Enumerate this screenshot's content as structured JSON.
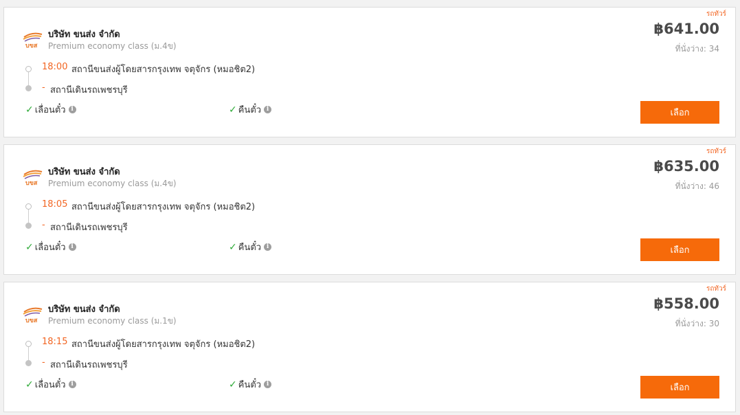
{
  "results": [
    {
      "tag": "รถทัวร์",
      "company": "บริษัท ขนส่ง จำกัด",
      "service_class": "Premium economy class (ม.4ข)",
      "price": "฿641.00",
      "seats": "ที่นั่งว่าง: 34",
      "departure_time": "18:00",
      "departure_station": "สถานีขนส่งผู้โดยสารกรุงเทพ จตุจักร (หมอชิต2)",
      "arrival_time": "-",
      "arrival_station": "สถานีเดินรถเพชรบุรี",
      "feature_1": "เลื่อนตั๋ว",
      "feature_2": "คืนตั๋ว",
      "select_label": "เลือก"
    },
    {
      "tag": "รถทัวร์",
      "company": "บริษัท ขนส่ง จำกัด",
      "service_class": "Premium economy class (ม.4ข)",
      "price": "฿635.00",
      "seats": "ที่นั่งว่าง: 46",
      "departure_time": "18:05",
      "departure_station": "สถานีขนส่งผู้โดยสารกรุงเทพ จตุจักร (หมอชิต2)",
      "arrival_time": "-",
      "arrival_station": "สถานีเดินรถเพชรบุรี",
      "feature_1": "เลื่อนตั๋ว",
      "feature_2": "คืนตั๋ว",
      "select_label": "เลือก"
    },
    {
      "tag": "รถทัวร์",
      "company": "บริษัท ขนส่ง จำกัด",
      "service_class": "Premium economy class (ม.1ข)",
      "price": "฿558.00",
      "seats": "ที่นั่งว่าง: 30",
      "departure_time": "18:15",
      "departure_station": "สถานีขนส่งผู้โดยสารกรุงเทพ จตุจักร (หมอชิต2)",
      "arrival_time": "-",
      "arrival_station": "สถานีเดินรถเพชรบุรี",
      "feature_1": "เลื่อนตั๋ว",
      "feature_2": "คืนตั๋ว",
      "select_label": "เลือก"
    }
  ],
  "icons": {
    "logo": "bks-logo-icon",
    "check": "check-icon",
    "info": "info-icon"
  },
  "colors": {
    "accent": "#f66a0a",
    "time": "#f26522",
    "check": "#2eaa38",
    "price": "#4a4a4a"
  }
}
